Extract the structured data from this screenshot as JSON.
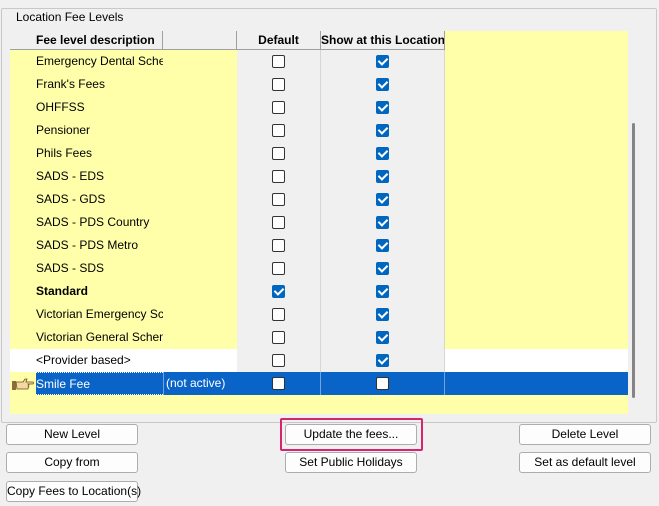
{
  "group_title": "Location Fee Levels",
  "columns": {
    "description": "Fee level description",
    "default": "Default",
    "show": "Show at this Location"
  },
  "rows": [
    {
      "description": "Emergency Dental Scheme",
      "status": "",
      "default": false,
      "show": true,
      "bold": false
    },
    {
      "description": "Frank's Fees",
      "status": "",
      "default": false,
      "show": true,
      "bold": false
    },
    {
      "description": "OHFFSS",
      "status": "",
      "default": false,
      "show": true,
      "bold": false
    },
    {
      "description": "Pensioner",
      "status": "",
      "default": false,
      "show": true,
      "bold": false
    },
    {
      "description": "Phils Fees",
      "status": "",
      "default": false,
      "show": true,
      "bold": false
    },
    {
      "description": "SADS - EDS",
      "status": "",
      "default": false,
      "show": true,
      "bold": false
    },
    {
      "description": "SADS - GDS",
      "status": "",
      "default": false,
      "show": true,
      "bold": false
    },
    {
      "description": "SADS - PDS Country",
      "status": "",
      "default": false,
      "show": true,
      "bold": false
    },
    {
      "description": "SADS - PDS Metro",
      "status": "",
      "default": false,
      "show": true,
      "bold": false
    },
    {
      "description": "SADS - SDS",
      "status": "",
      "default": false,
      "show": true,
      "bold": false
    },
    {
      "description": "Standard",
      "status": "",
      "default": true,
      "show": true,
      "bold": true
    },
    {
      "description": "Victorian Emergency Scheme",
      "status": "",
      "default": false,
      "show": true,
      "bold": false
    },
    {
      "description": "Victorian General Scheme",
      "status": "",
      "default": false,
      "show": true,
      "bold": false
    },
    {
      "description": "<Provider based>",
      "status": "",
      "default": false,
      "show": true,
      "bold": false,
      "white": true
    },
    {
      "description": "Smile Fee",
      "status": "(not active)",
      "default": false,
      "show": false,
      "bold": false,
      "selected": true
    }
  ],
  "buttons": {
    "new_level": "New Level",
    "copy_from": "Copy from",
    "copy_fees_to_location": "Copy Fees to Location(s)",
    "update_fees": "Update the fees...",
    "set_public_holidays": "Set Public Holidays",
    "delete_level": "Delete Level",
    "set_default_level": "Set as default level"
  },
  "colors": {
    "grid_background": "#ffffaa",
    "selection": "#0a64c8",
    "checkbox_checked": "#0067c0",
    "highlight_box": "#d6246e"
  },
  "icons": {
    "row_pointer": "pointing-hand-icon"
  }
}
